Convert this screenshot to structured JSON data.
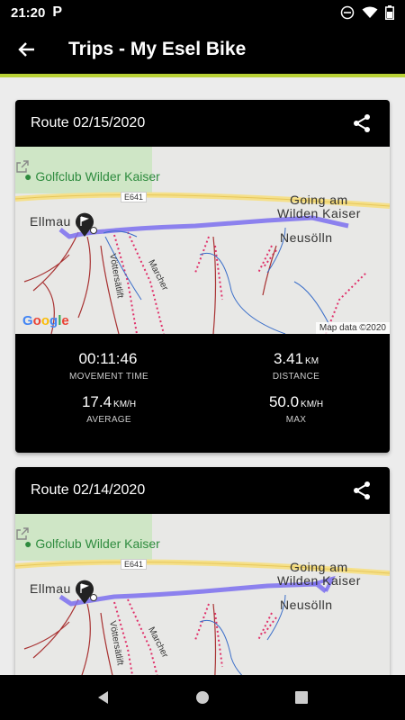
{
  "status": {
    "time": "21:20",
    "app_icon": "P"
  },
  "appbar": {
    "title": "Trips - My Esel Bike"
  },
  "trips": [
    {
      "title": "Route 02/15/2020",
      "map": {
        "poi": "Golfclub Wilder Kaiser",
        "road": "E641",
        "town1": "Ellmau",
        "town2_line1": "Going am",
        "town2_line2": "Wilden Kaiser",
        "town3": "Neusölln",
        "street1": "Vöttersätlift",
        "street2": "Marcher",
        "attribution": "Map data ©2020",
        "logo": "Google"
      },
      "stats": [
        {
          "value": "00:11:46",
          "unit": "",
          "label": "MOVEMENT TIME"
        },
        {
          "value": "3.41",
          "unit": "KM",
          "label": "DISTANCE"
        },
        {
          "value": "17.4",
          "unit": "KM/H",
          "label": "AVERAGE"
        },
        {
          "value": "50.0",
          "unit": "KM/H",
          "label": "MAX"
        }
      ]
    },
    {
      "title": "Route 02/14/2020",
      "map": {
        "poi": "Golfclub Wilder Kaiser",
        "road": "E641",
        "town1": "Ellmau",
        "town2_line1": "Going am",
        "town2_line2": "Wilden Kaiser",
        "town3": "Neusölln",
        "street1": "Vöttersätlift",
        "street2": "Marcher"
      }
    }
  ],
  "colors": {
    "accent": "#b9d236",
    "route": "#7b6fee",
    "bar": "#000000"
  }
}
